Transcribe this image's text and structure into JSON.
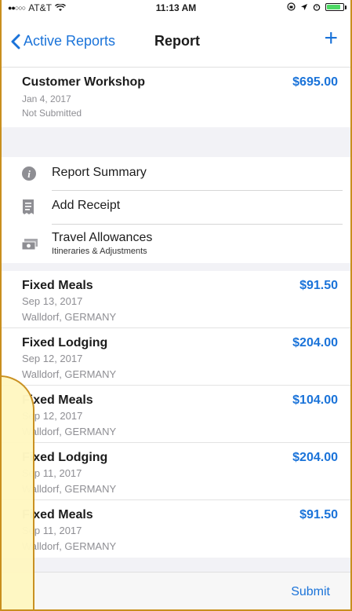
{
  "status_bar": {
    "signal": "●●○○○",
    "carrier": "AT&T",
    "time": "11:13 AM",
    "battery_level": 0.85
  },
  "nav": {
    "back_label": "Active Reports",
    "title": "Report",
    "add_label": "+"
  },
  "report": {
    "name": "Customer Workshop",
    "amount": "$695.00",
    "date": "Jan 4, 2017",
    "status": "Not Submitted"
  },
  "menu": {
    "summary_label": "Report Summary",
    "add_receipt_label": "Add Receipt",
    "travel_label": "Travel Allowances",
    "travel_sub": "Itineraries & Adjustments"
  },
  "expenses": [
    {
      "type": "Fixed Meals",
      "amount": "$91.50",
      "date": "Sep 13, 2017",
      "location": "Walldorf, GERMANY"
    },
    {
      "type": "Fixed Lodging",
      "amount": "$204.00",
      "date": "Sep 12, 2017",
      "location": "Walldorf, GERMANY"
    },
    {
      "type": "Fixed Meals",
      "amount": "$104.00",
      "date": "Sep 12, 2017",
      "location": "Walldorf, GERMANY"
    },
    {
      "type": "Fixed Lodging",
      "amount": "$204.00",
      "date": "Sep 11, 2017",
      "location": "Walldorf, GERMANY"
    },
    {
      "type": "Fixed Meals",
      "amount": "$91.50",
      "date": "Sep 11, 2017",
      "location": "Walldorf, GERMANY"
    }
  ],
  "toolbar": {
    "submit_label": "Submit"
  },
  "colors": {
    "accent": "#1a73d9",
    "frame": "#c98f1e",
    "overlay": "#fff7c2",
    "battery": "#4cd964"
  }
}
